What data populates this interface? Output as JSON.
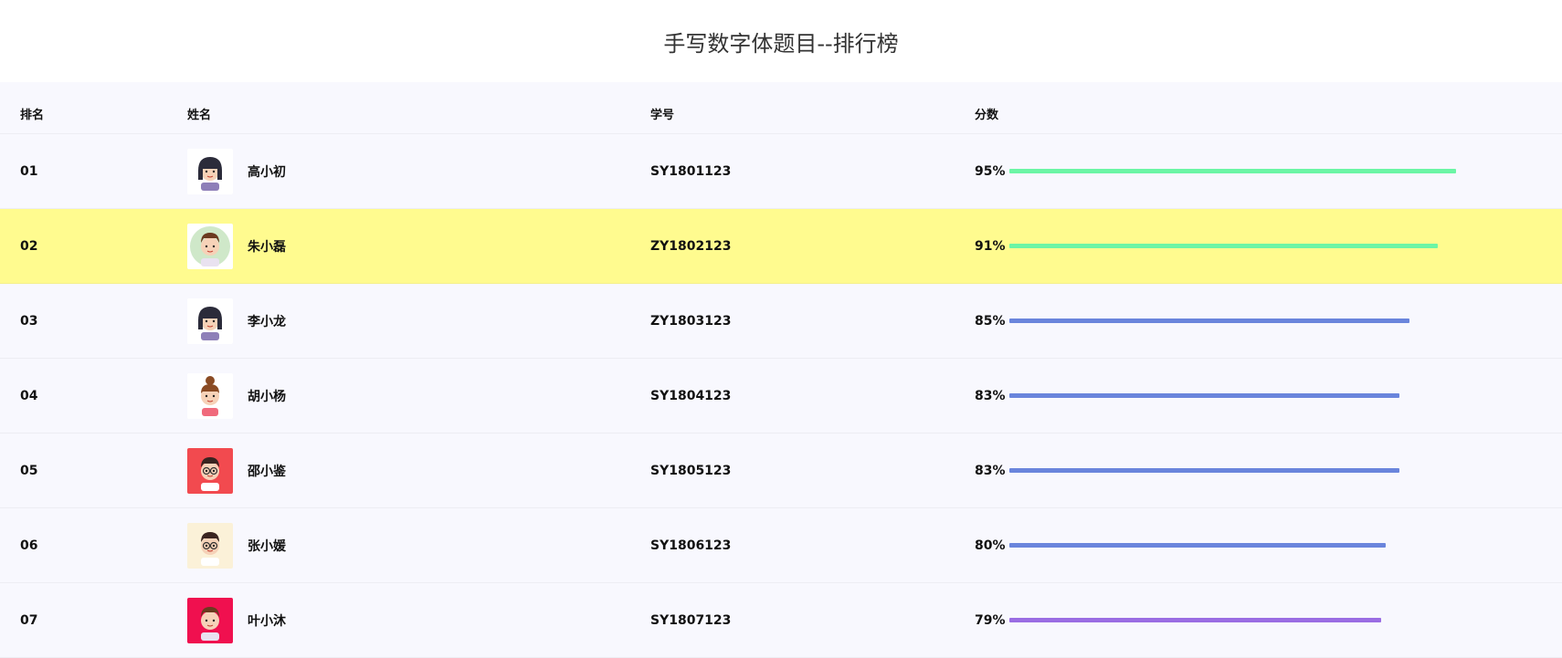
{
  "page_title": "手写数字体题目--排行榜",
  "headers": {
    "rank": "排名",
    "name": "姓名",
    "id": "学号",
    "score": "分数"
  },
  "rows": [
    {
      "rank": "01",
      "name": "高小初",
      "id": "SY1801123",
      "score_label": "95%",
      "score": 95,
      "bar_color": "#6cf5a5",
      "avatar": "girl-avatar",
      "avatar_bg": "#ffffff",
      "highlighted": false
    },
    {
      "rank": "02",
      "name": "朱小磊",
      "id": "ZY1802123",
      "score_label": "91%",
      "score": 91,
      "bar_color": "#6cf5a5",
      "avatar": "man-avatar",
      "avatar_bg": "#ffffff",
      "highlighted": true
    },
    {
      "rank": "03",
      "name": "李小龙",
      "id": "ZY1803123",
      "score_label": "85%",
      "score": 85,
      "bar_color": "#6a85dc",
      "avatar": "girl-avatar",
      "avatar_bg": "#ffffff",
      "highlighted": false
    },
    {
      "rank": "04",
      "name": "胡小杨",
      "id": "SY1804123",
      "score_label": "83%",
      "score": 83,
      "bar_color": "#6a85dc",
      "avatar": "woman-bun-avatar",
      "avatar_bg": "#ffffff",
      "highlighted": false
    },
    {
      "rank": "05",
      "name": "邵小鉴",
      "id": "SY1805123",
      "score_label": "83%",
      "score": 83,
      "bar_color": "#6a85dc",
      "avatar": "man-glasses-avatar",
      "avatar_bg": "#f24a4f",
      "highlighted": false
    },
    {
      "rank": "06",
      "name": "张小媛",
      "id": "SY1806123",
      "score_label": "80%",
      "score": 80,
      "bar_color": "#6a85dc",
      "avatar": "man-glasses-avatar",
      "avatar_bg": "#fbf1d8",
      "highlighted": false
    },
    {
      "rank": "07",
      "name": "叶小沐",
      "id": "SY1807123",
      "score_label": "79%",
      "score": 79,
      "bar_color": "#9a6de3",
      "avatar": "man-avatar",
      "avatar_bg": "#f0104f",
      "highlighted": false
    }
  ]
}
